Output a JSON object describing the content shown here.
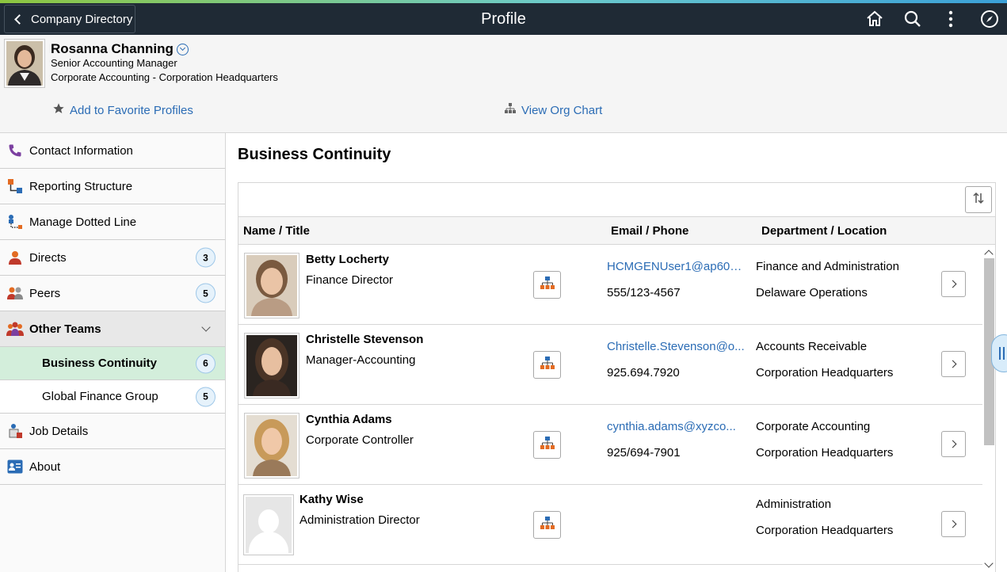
{
  "banner": {
    "back_label": "Company Directory",
    "title": "Profile",
    "icons": [
      "home-icon",
      "search-icon",
      "more-vertical-icon",
      "compass-icon"
    ]
  },
  "profile": {
    "name": "Rosanna Channing",
    "title": "Senior Accounting Manager",
    "department": "Corporate Accounting - Corporation Headquarters",
    "favorite_link": "Add to Favorite Profiles",
    "org_chart_link": "View Org Chart"
  },
  "nav": {
    "contact": "Contact Information",
    "reporting": "Reporting Structure",
    "dotted": "Manage Dotted Line",
    "directs": "Directs",
    "directs_count": "3",
    "peers": "Peers",
    "peers_count": "5",
    "other_teams": "Other Teams",
    "business_continuity": "Business Continuity",
    "business_continuity_count": "6",
    "global_finance": "Global Finance Group",
    "global_finance_count": "5",
    "job_details": "Job Details",
    "about": "About"
  },
  "main": {
    "section_title": "Business Continuity",
    "columns": {
      "name_title": "Name / Title",
      "email_phone": "Email / Phone",
      "dept_location": "Department / Location"
    },
    "rows": [
      {
        "name": "Betty Locherty",
        "title": "Finance Director",
        "email": "HCMGENUser1@ap602...",
        "phone": "555/123-4567",
        "department": "Finance and Administration",
        "location": "Delaware Operations"
      },
      {
        "name": "Christelle Stevenson",
        "title": "Manager-Accounting",
        "email": "Christelle.Stevenson@o...",
        "phone": "925.694.7920",
        "department": "Accounts Receivable",
        "location": "Corporation Headquarters"
      },
      {
        "name": "Cynthia Adams",
        "title": "Corporate Controller",
        "email": "cynthia.adams@xyzco...",
        "phone": "925/694-7901",
        "department": "Corporate Accounting",
        "location": "Corporation Headquarters"
      },
      {
        "name": "Kathy Wise",
        "title": "Administration Director",
        "email": "",
        "phone": "",
        "department": "Administration",
        "location": "Corporation Headquarters"
      }
    ]
  },
  "colors": {
    "banner_bg": "#1f2a35",
    "link": "#2b6cb5",
    "active_nav": "#d3eedb"
  }
}
